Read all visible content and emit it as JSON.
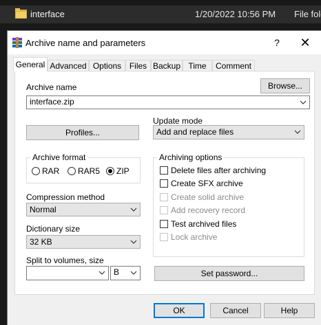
{
  "background": {
    "file_name": "interface",
    "file_date": "1/20/2022 10:56 PM",
    "file_type": "File fold"
  },
  "window": {
    "title": "Archive name and parameters",
    "help": "?",
    "close": "✕"
  },
  "tabs": [
    "General",
    "Advanced",
    "Options",
    "Files",
    "Backup",
    "Time",
    "Comment"
  ],
  "general": {
    "archive_name_label": "Archive name",
    "archive_name_value": "interface.zip",
    "browse_button": "Browse...",
    "profiles_button": "Profiles...",
    "update_mode_label": "Update mode",
    "update_mode_value": "Add and replace files",
    "archive_format_label": "Archive format",
    "formats": [
      "RAR",
      "RAR5",
      "ZIP"
    ],
    "selected_format": "ZIP",
    "compression_label": "Compression method",
    "compression_value": "Normal",
    "dictionary_label": "Dictionary size",
    "dictionary_value": "32 KB",
    "split_label": "Split to volumes, size",
    "split_value": "",
    "split_unit": "B",
    "archiving_options_label": "Archiving options",
    "options": [
      {
        "label": "Delete files after archiving",
        "checked": false,
        "enabled": true
      },
      {
        "label": "Create SFX archive",
        "checked": false,
        "enabled": true
      },
      {
        "label": "Create solid archive",
        "checked": false,
        "enabled": false
      },
      {
        "label": "Add recovery record",
        "checked": false,
        "enabled": false
      },
      {
        "label": "Test archived files",
        "checked": false,
        "enabled": true
      },
      {
        "label": "Lock archive",
        "checked": false,
        "enabled": false
      }
    ],
    "set_password_button": "Set password..."
  },
  "footer": {
    "ok": "OK",
    "cancel": "Cancel",
    "help": "Help"
  },
  "colors": {
    "accent": "#0078d7",
    "background_dark": "#191919",
    "dialog": "#f0f0f0"
  }
}
